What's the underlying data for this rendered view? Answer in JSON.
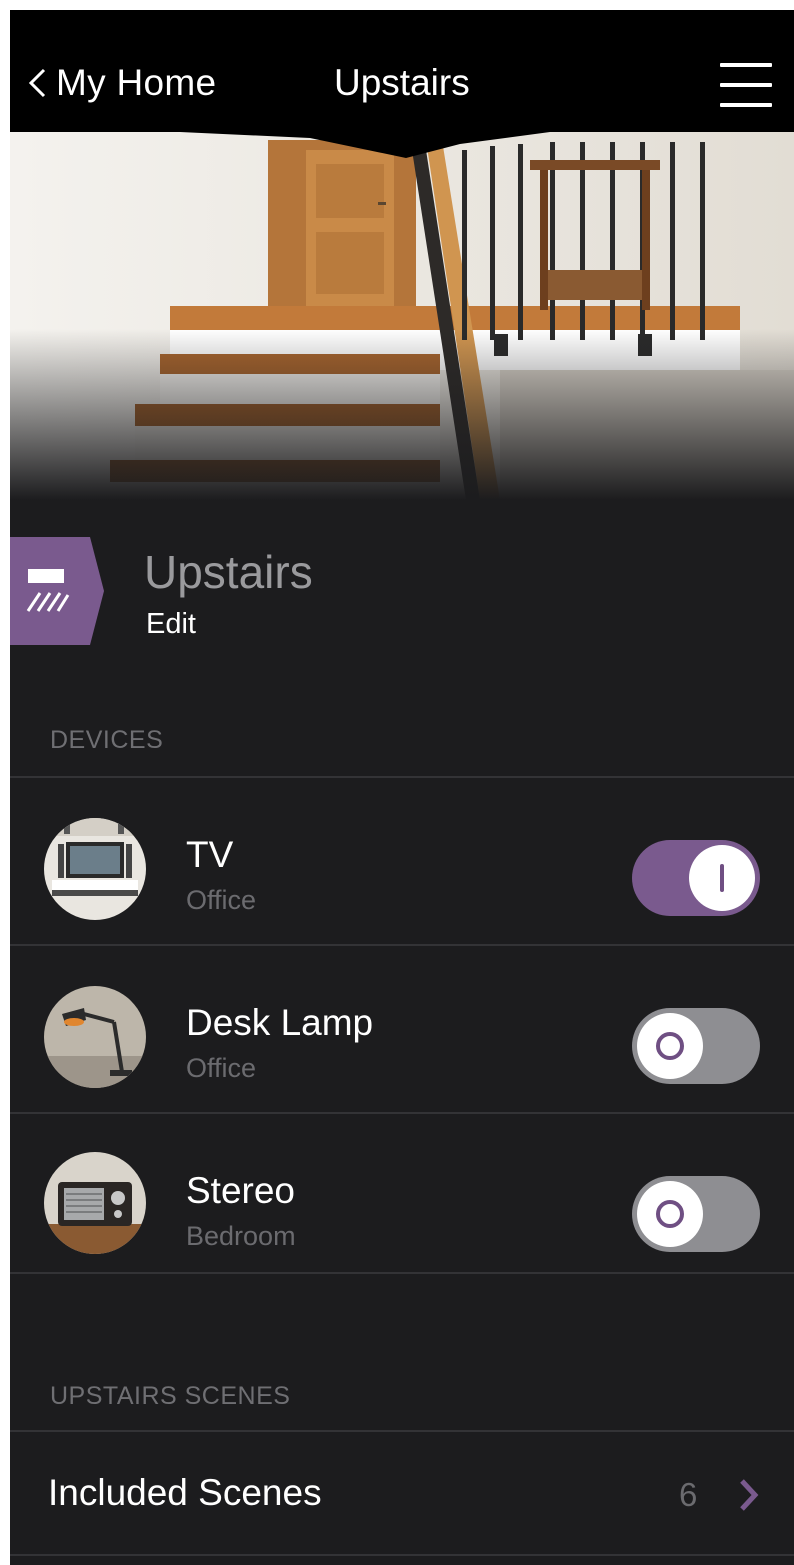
{
  "header": {
    "back_label": "My Home",
    "title": "Upstairs"
  },
  "room": {
    "name": "Upstairs",
    "edit_label": "Edit",
    "icon": "room-icon"
  },
  "devices_section": {
    "label": "DEVICES",
    "items": [
      {
        "name": "TV",
        "room": "Office",
        "on": true,
        "icon": "tv-thumbnail"
      },
      {
        "name": "Desk Lamp",
        "room": "Office",
        "on": false,
        "icon": "desk-lamp-thumbnail"
      },
      {
        "name": "Stereo",
        "room": "Bedroom",
        "on": false,
        "icon": "stereo-thumbnail"
      }
    ]
  },
  "scenes_section": {
    "label": "UPSTAIRS SCENES",
    "row_label": "Included Scenes",
    "count": "6"
  },
  "colors": {
    "accent": "#7a5a8e",
    "background": "#1c1c1e",
    "toggle_off": "#8e8e92"
  }
}
